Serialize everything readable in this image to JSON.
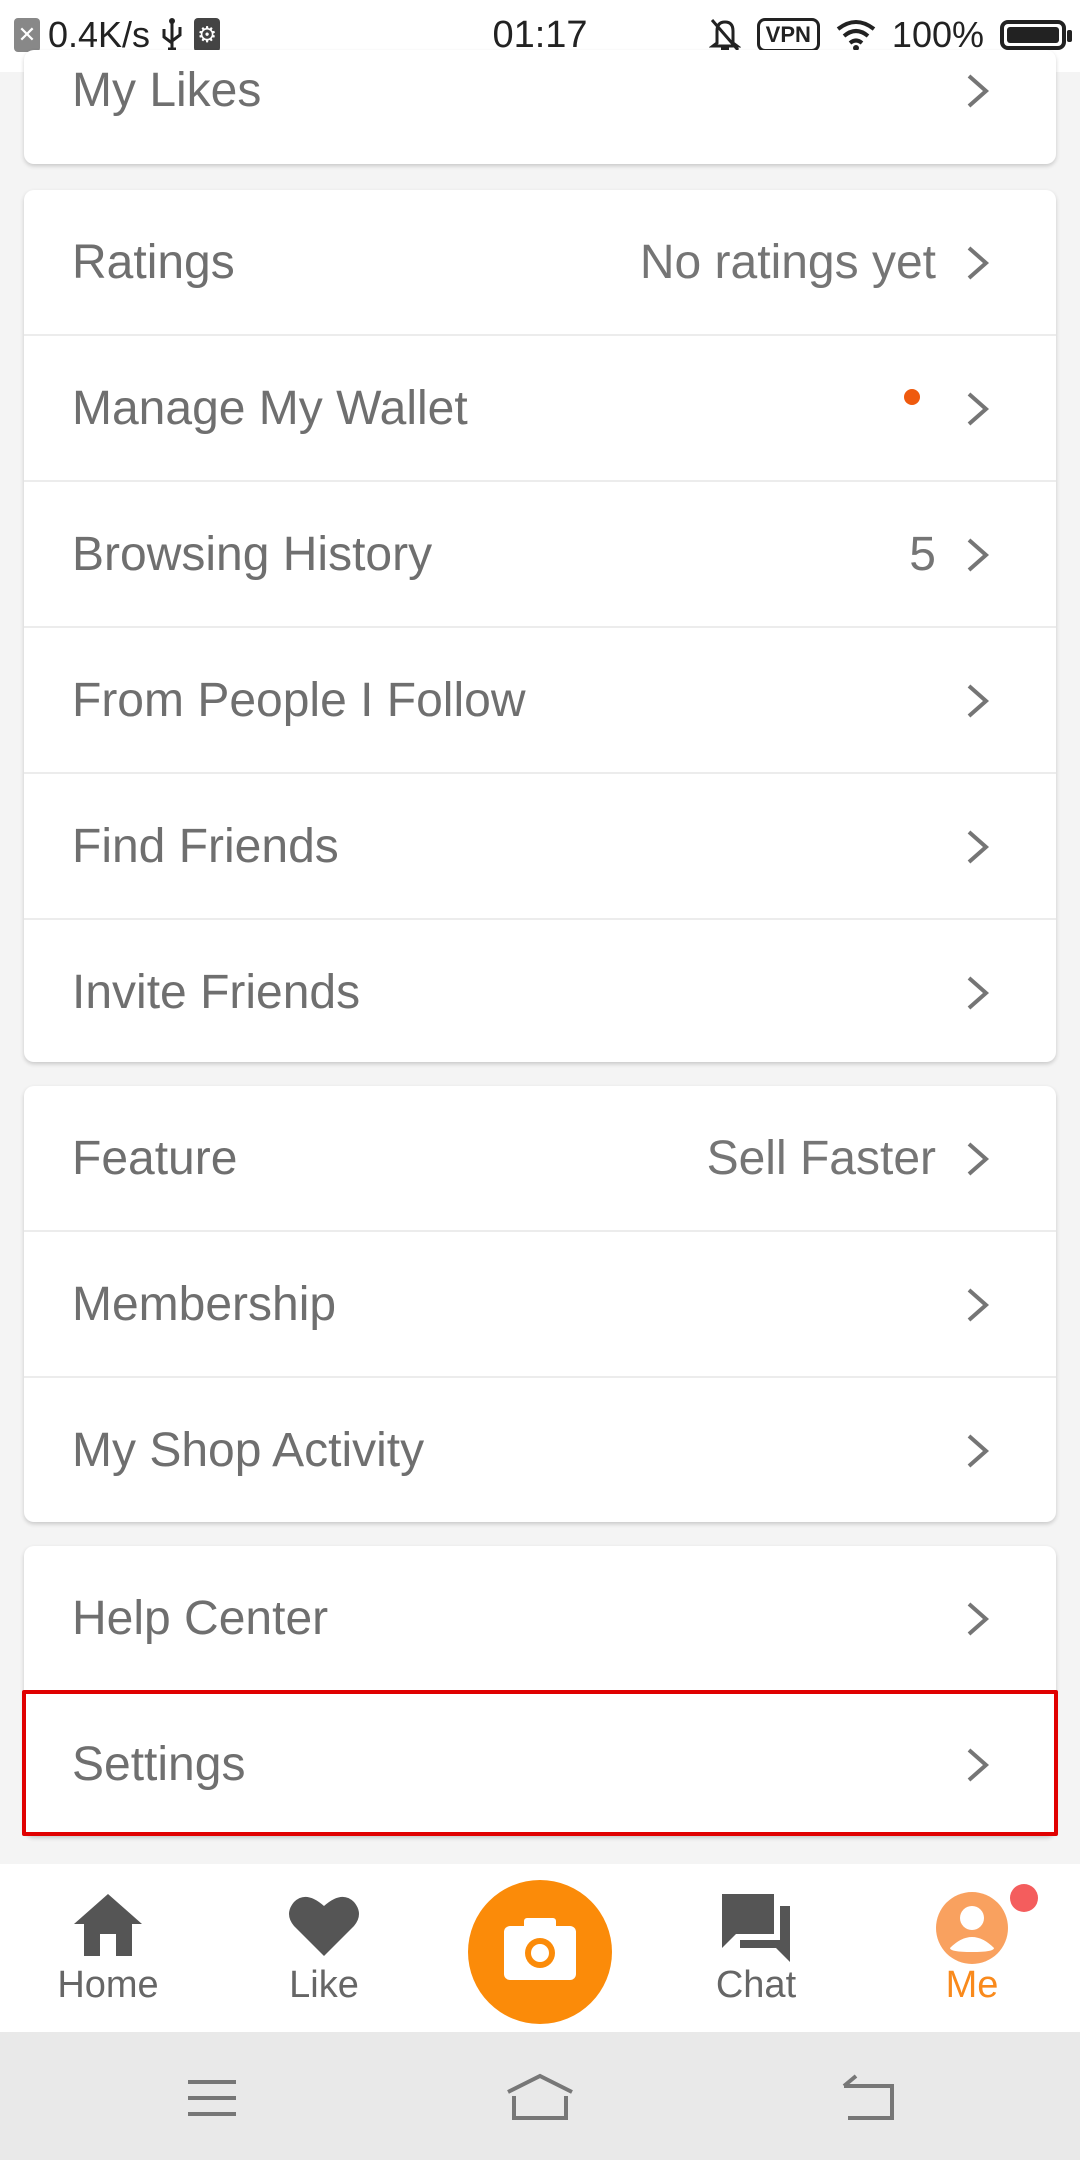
{
  "status_bar": {
    "net_speed": "0.4K/s",
    "time": "01:17",
    "vpn_label": "VPN",
    "battery": "100%",
    "icons": [
      "close-notification-icon",
      "usb-icon",
      "usb-debug-icon",
      "mute-bell-icon",
      "vpn-icon",
      "wifi-icon",
      "battery-icon"
    ]
  },
  "groups": [
    {
      "rows": [
        {
          "label": "My Likes",
          "value": ""
        }
      ]
    },
    {
      "rows": [
        {
          "label": "Ratings",
          "value": "No ratings yet"
        },
        {
          "label": "Manage My Wallet",
          "value": "",
          "notification_dot": true
        },
        {
          "label": "Browsing History",
          "value": "5"
        },
        {
          "label": "From People I Follow",
          "value": ""
        },
        {
          "label": "Find Friends",
          "value": ""
        },
        {
          "label": "Invite Friends",
          "value": ""
        }
      ]
    },
    {
      "rows": [
        {
          "label": "Feature",
          "value": "Sell Faster"
        },
        {
          "label": "Membership",
          "value": ""
        },
        {
          "label": "My Shop Activity",
          "value": ""
        }
      ]
    },
    {
      "rows": [
        {
          "label": "Help Center",
          "value": ""
        },
        {
          "label": "Settings",
          "value": ""
        }
      ]
    }
  ],
  "tab_bar": {
    "tabs": [
      {
        "label": "Home",
        "icon": "home-icon"
      },
      {
        "label": "Like",
        "icon": "heart-icon"
      },
      {
        "label": "",
        "icon": "camera-icon"
      },
      {
        "label": "Chat",
        "icon": "chat-icon"
      },
      {
        "label": "Me",
        "icon": "profile-icon",
        "active": true
      }
    ],
    "active_color": "#f98a1c",
    "camera_color": "#fb8b09"
  },
  "colors": {
    "highlight": "#e00000",
    "notification_dot": "#ef5a0e",
    "badge": "#f45d5d"
  },
  "nav_bar": {
    "icons": [
      "menu-icon",
      "home-nav-icon",
      "back-icon"
    ]
  }
}
